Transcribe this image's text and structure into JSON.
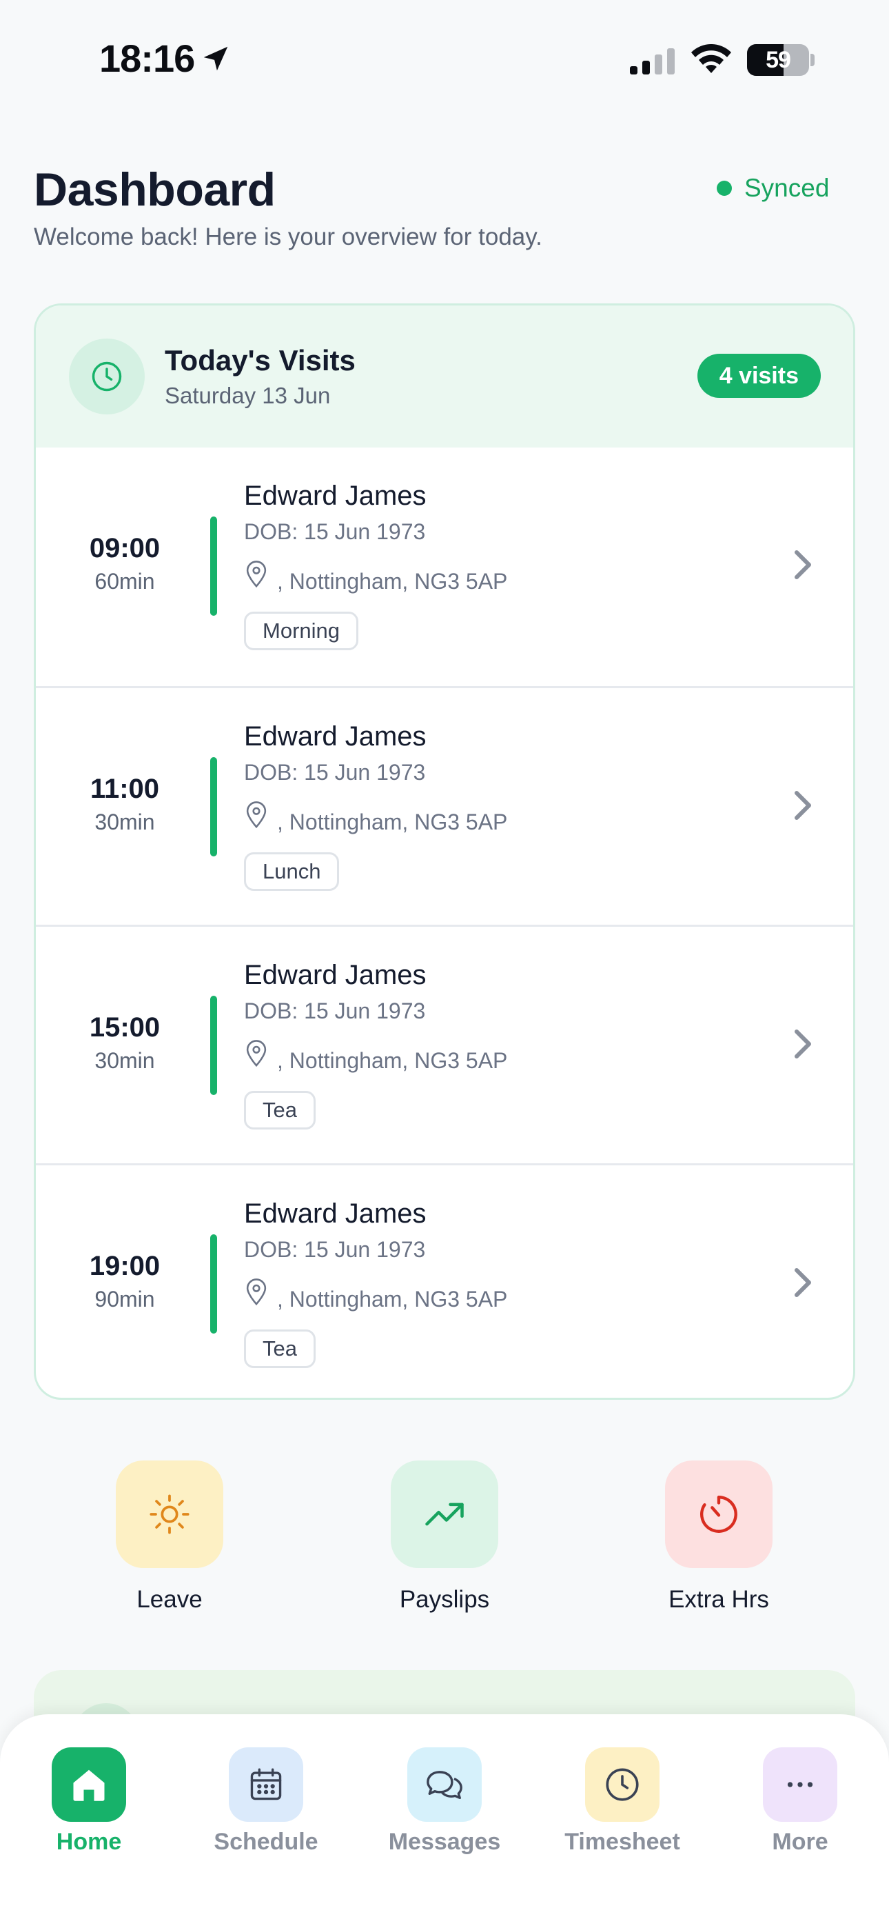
{
  "status_bar": {
    "time": "18:16",
    "battery": "59",
    "battery_level_percent": 59
  },
  "header": {
    "title": "Dashboard",
    "subtitle": "Welcome back! Here is your overview for today.",
    "sync_status": "Synced"
  },
  "visits_card": {
    "title": "Today's Visits",
    "date": "Saturday 13 Jun",
    "count_badge": "4 visits",
    "visits": [
      {
        "time": "09:00",
        "duration": "60min",
        "name": "Edward James",
        "dob": "DOB: 15 Jun 1973",
        "address": ", Nottingham, NG3 5AP",
        "tag": "Morning"
      },
      {
        "time": "11:00",
        "duration": "30min",
        "name": "Edward James",
        "dob": "DOB: 15 Jun 1973",
        "address": ", Nottingham, NG3 5AP",
        "tag": "Lunch"
      },
      {
        "time": "15:00",
        "duration": "30min",
        "name": "Edward James",
        "dob": "DOB: 15 Jun 1973",
        "address": ", Nottingham, NG3 5AP",
        "tag": "Tea"
      },
      {
        "time": "19:00",
        "duration": "90min",
        "name": "Edward James",
        "dob": "DOB: 15 Jun 1973",
        "address": ", Nottingham, NG3 5AP",
        "tag": "Tea"
      }
    ]
  },
  "quick_actions": [
    {
      "label": "Leave",
      "icon": "sun-icon",
      "bg": "#fdf0c4",
      "color": "#e0871b"
    },
    {
      "label": "Payslips",
      "icon": "trending-up-icon",
      "bg": "#dcf4e7",
      "color": "#17a35e"
    },
    {
      "label": "Extra Hrs",
      "icon": "timer-icon",
      "bg": "#fde0e0",
      "color": "#d92d20"
    }
  ],
  "bottom_nav": [
    {
      "label": "Home",
      "icon": "home-icon",
      "active": true,
      "bg": "#17b26a"
    },
    {
      "label": "Schedule",
      "icon": "calendar-icon",
      "active": false,
      "bg": "#dbeafb"
    },
    {
      "label": "Messages",
      "icon": "chat-icon",
      "active": false,
      "bg": "#d6f1fb"
    },
    {
      "label": "Timesheet",
      "icon": "clock-icon",
      "active": false,
      "bg": "#fdf0c4"
    },
    {
      "label": "More",
      "icon": "more-icon",
      "active": false,
      "bg": "#efe3fb"
    }
  ],
  "colors": {
    "accent": "#17b26a",
    "text_primary": "#141b2d",
    "text_secondary": "#5b6475"
  }
}
